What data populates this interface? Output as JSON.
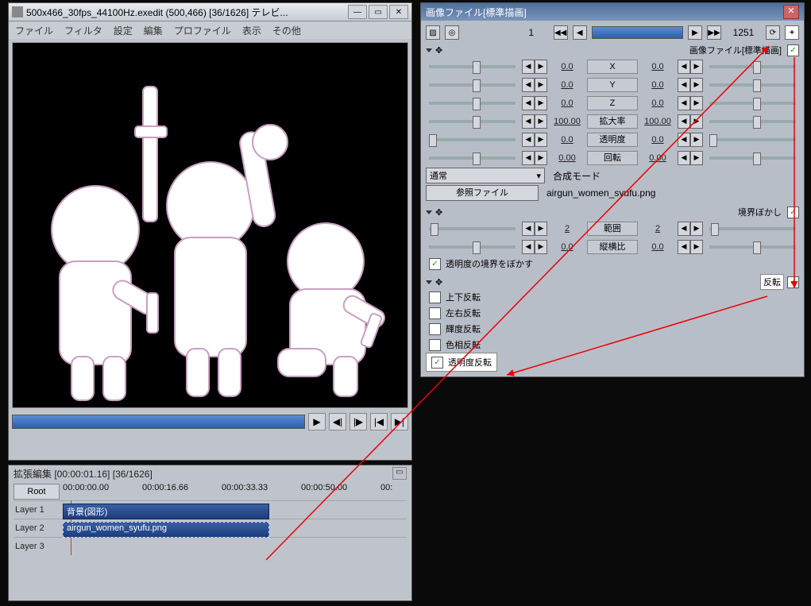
{
  "main_window": {
    "title": "500x466_30fps_44100Hz.exedit (500,466) [36/1626] テレビ...",
    "menus": [
      "ファイル",
      "フィルタ",
      "設定",
      "編集",
      "プロファイル",
      "表示",
      "その他"
    ]
  },
  "timeline": {
    "title": "拡張編集 [00:00:01.16] [36/1626]",
    "root": "Root",
    "times": [
      "00:00:00.00",
      "00:00:16.66",
      "00:00:33.33",
      "00:00:50.00",
      "00:"
    ],
    "layers": [
      "Layer 1",
      "Layer 2",
      "Layer 3"
    ],
    "clip1": "背景(図形)",
    "clip2": "airgun_women_syufu.png"
  },
  "props": {
    "title": "画像ファイル[標準描画]",
    "frame_start": "1",
    "frame_end": "1251",
    "section1": "画像ファイル[標準描画]",
    "x": {
      "label": "X",
      "v": "0.0"
    },
    "y": {
      "label": "Y",
      "v": "0.0"
    },
    "z": {
      "label": "Z",
      "v": "0.0"
    },
    "scale": {
      "label": "拡大率",
      "v": "100.00"
    },
    "alpha": {
      "label": "透明度",
      "v": "0.0"
    },
    "rot": {
      "label": "回転",
      "v": "0.00"
    },
    "blend": {
      "label": "合成モード",
      "value": "通常"
    },
    "ref": {
      "label": "参照ファイル",
      "value": "airgun_women_syufu.png"
    },
    "section2": "境界ぼかし",
    "range": {
      "label": "範囲",
      "v": "2"
    },
    "aspect": {
      "label": "縦横比",
      "v": "0.0"
    },
    "blur_alpha": "透明度の境界をぼかす",
    "section3": "反転",
    "flip_v": "上下反転",
    "flip_h": "左右反転",
    "flip_lum": "輝度反転",
    "flip_hue": "色相反転",
    "flip_alpha": "透明度反転"
  }
}
